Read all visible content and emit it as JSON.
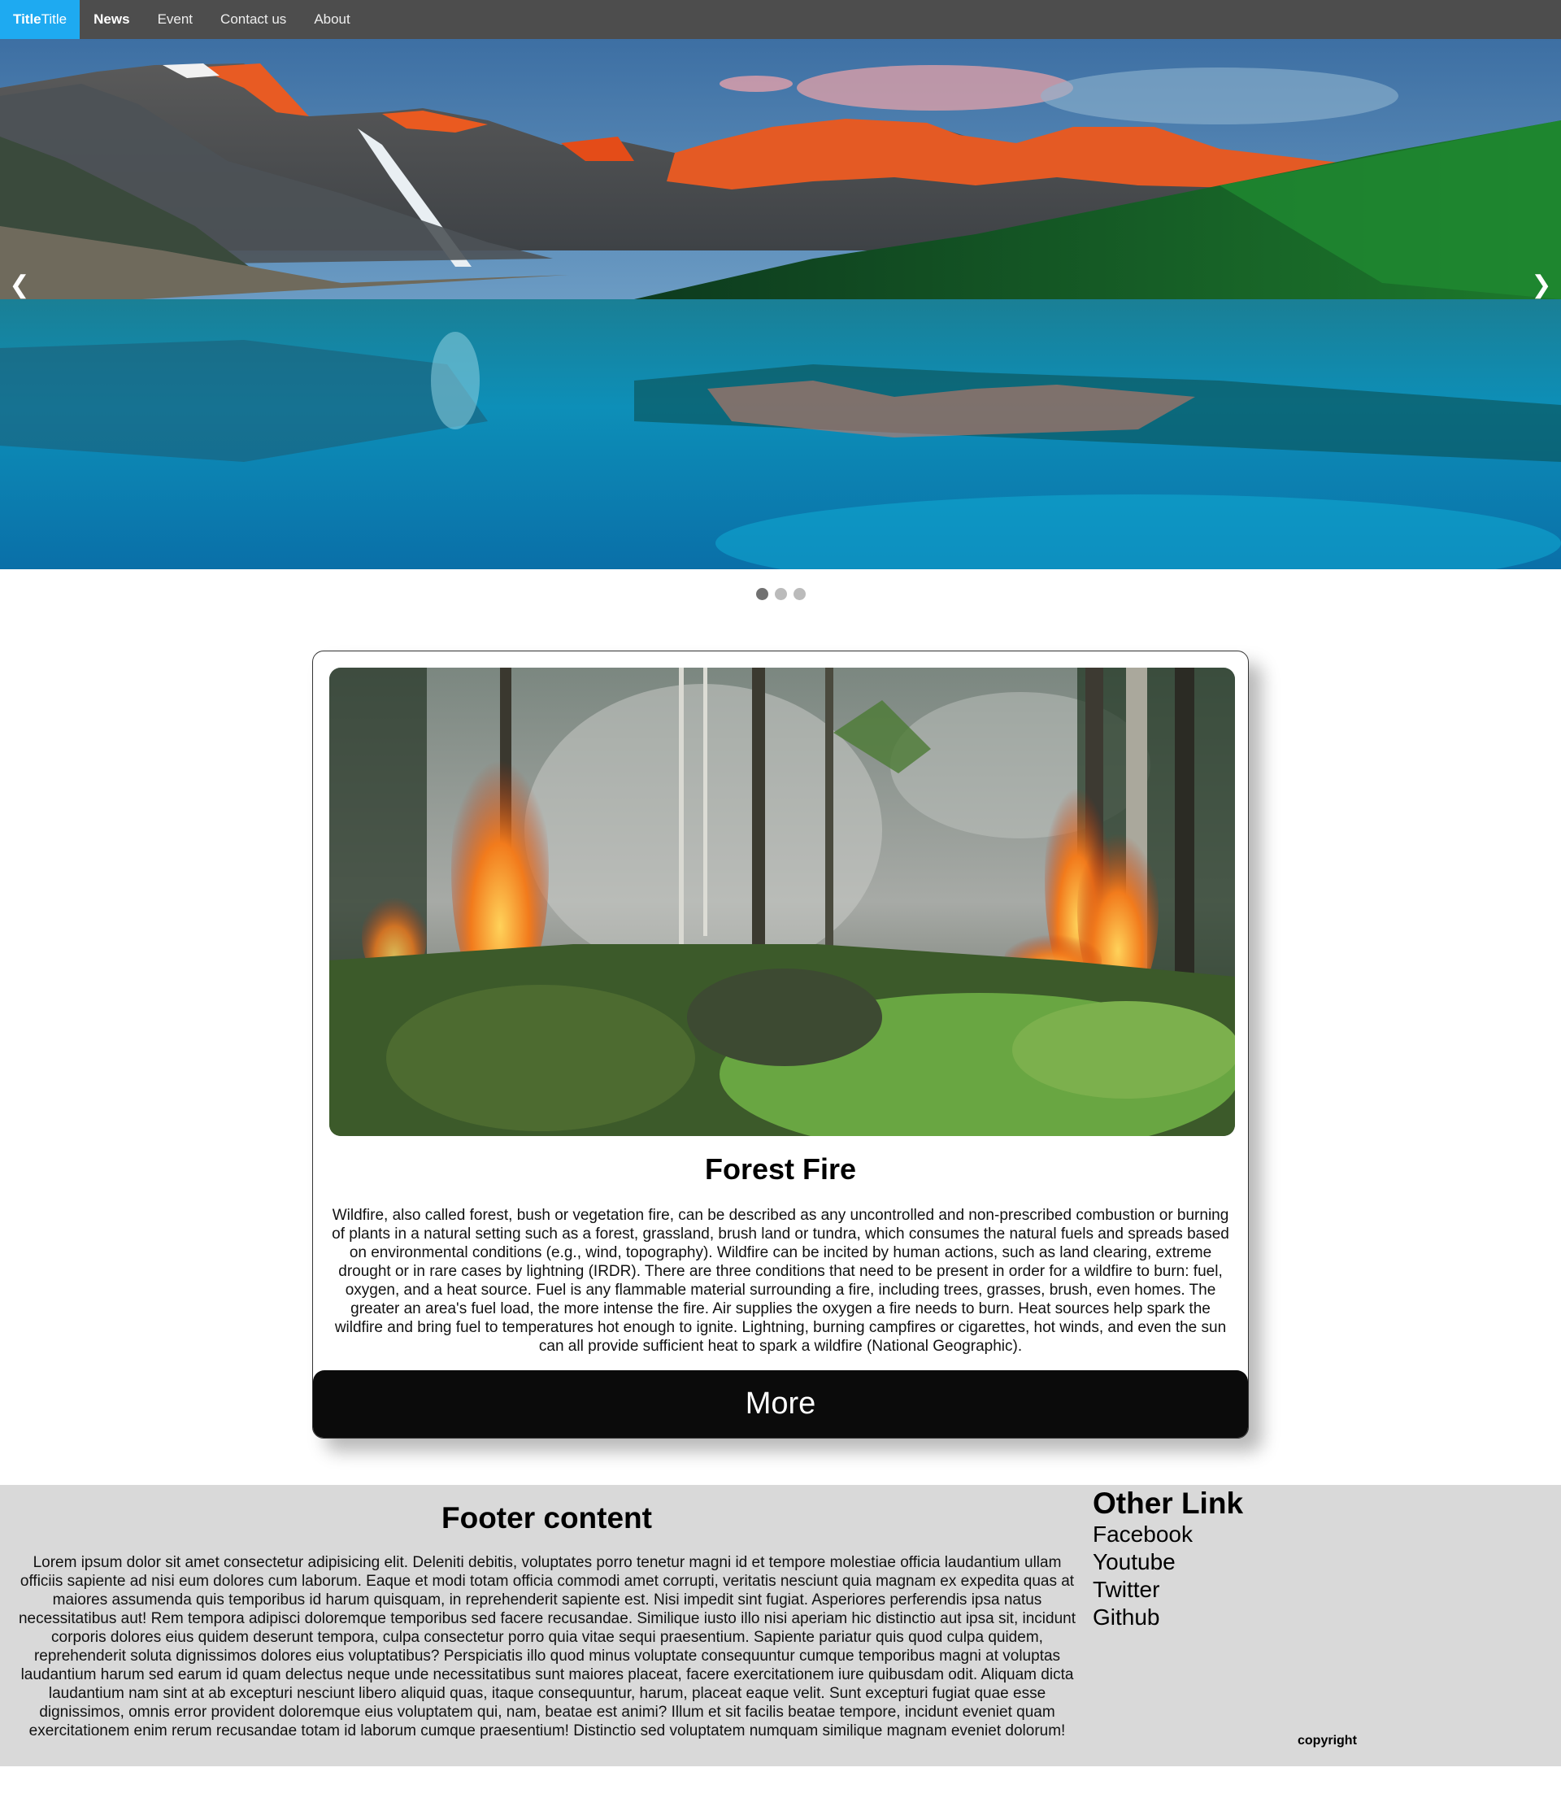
{
  "navbar": {
    "brand_bold": "Title",
    "brand_rest": "Title",
    "links": [
      "News",
      "Event",
      "Contact us",
      "About"
    ],
    "active_link": "News",
    "brand_color": "#1eaaf1",
    "bg_color": "#4d4d4d"
  },
  "carousel": {
    "prev_icon": "❮",
    "next_icon": "❯",
    "slide_count": 3,
    "active_slide": 1,
    "image": "mountain-lake-landscape"
  },
  "card": {
    "image": "forest-fire-photo",
    "title": "Forest Fire",
    "body": "Wildfire, also called forest, bush or vegetation fire, can be described as any uncontrolled and non-prescribed combustion or burning of plants in a natural setting such as a forest, grassland, brush land or tundra, which consumes the natural fuels and spreads based on environmental conditions (e.g., wind, topography). Wildfire can be incited by human actions, such as land clearing, extreme drought or in rare cases by lightning (IRDR). There are three conditions that need to be present in order for a wildfire to burn: fuel, oxygen, and a heat source. Fuel is any flammable material surrounding a fire, including trees, grasses, brush, even homes. The greater an area's fuel load, the more intense the fire. Air supplies the oxygen a fire needs to burn. Heat sources help spark the wildfire and bring fuel to temperatures hot enough to ignite. Lightning, burning campfires or cigarettes, hot winds, and even the sun can all provide sufficient heat to spark a wildfire (National Geographic).",
    "button_label": "More"
  },
  "footer": {
    "title": "Footer content",
    "body": "Lorem ipsum dolor sit amet consectetur adipisicing elit. Deleniti debitis, voluptates porro tenetur magni id et tempore molestiae officia laudantium ullam officiis sapiente ad nisi eum dolores cum laborum. Eaque et modi totam officia commodi amet corrupti, veritatis nesciunt quia magnam ex expedita quas at maiores assumenda quis temporibus id harum quisquam, in reprehenderit sapiente est. Nisi impedit sint fugiat. Asperiores perferendis ipsa natus necessitatibus aut! Rem tempora adipisci doloremque temporibus sed facere recusandae. Similique iusto illo nisi aperiam hic distinctio aut ipsa sit, incidunt corporis dolores eius quidem deserunt tempora, culpa consectetur porro quia vitae sequi praesentium. Sapiente pariatur quis quod culpa quidem, reprehenderit soluta dignissimos dolores eius voluptatibus? Perspiciatis illo quod minus voluptate consequuntur cumque temporibus magni at voluptas laudantium harum sed earum id quam delectus neque unde necessitatibus sunt maiores placeat, facere exercitationem iure quibusdam odit. Aliquam dicta laudantium nam sint at ab excepturi nesciunt libero aliquid quas, itaque consequuntur, harum, placeat eaque velit. Sunt excepturi fugiat quae esse dignissimos, omnis error provident doloremque eius voluptatem qui, nam, beatae est animi? Illum et sit facilis beatae tempore, incidunt eveniet quam exercitationem enim rerum recusandae totam id laborum cumque praesentium! Distinctio sed voluptatem numquam similique magnam eveniet dolorum!",
    "other_title": "Other Link",
    "links": [
      "Facebook",
      "Youtube",
      "Twitter",
      "Github"
    ],
    "copyright": "copyright",
    "bg_color": "#d9d9d9"
  }
}
